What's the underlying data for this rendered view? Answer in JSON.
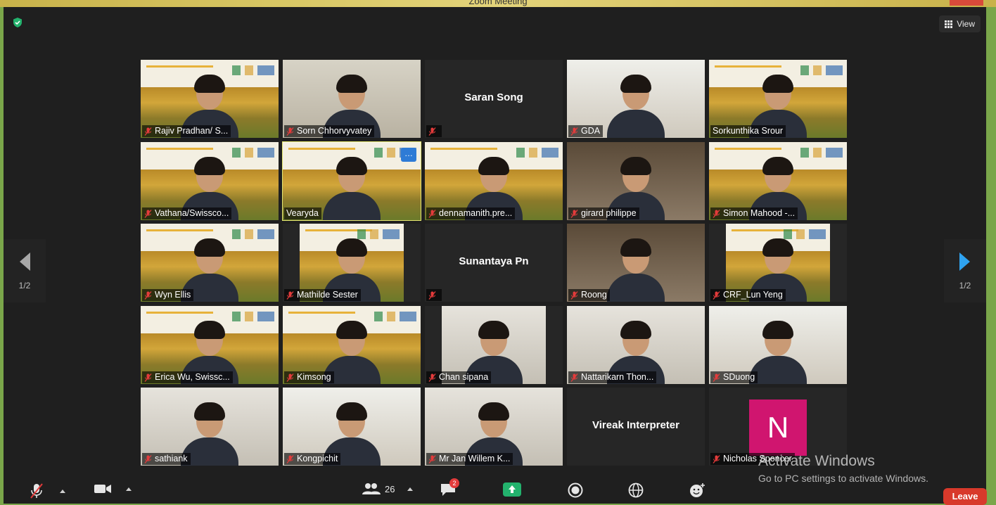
{
  "window": {
    "title": "Zoom Meeting"
  },
  "header": {
    "view_label": "View"
  },
  "pagination": {
    "current": "1/2"
  },
  "participants": [
    {
      "name": "Rajiv Pradhan/ S...",
      "muted": true,
      "video": "rice"
    },
    {
      "name": "Sorn Chhorvyvatey",
      "muted": true,
      "video": "office"
    },
    {
      "name": "",
      "center_name": "Saran Song",
      "muted": true,
      "video": "none"
    },
    {
      "name": "GDA",
      "muted": true,
      "video": "room"
    },
    {
      "name": "Sorkunthika Srour",
      "muted": false,
      "video": "rice"
    },
    {
      "name": "Vathana/Swissco...",
      "muted": true,
      "video": "rice"
    },
    {
      "name": "Vearyda",
      "muted": false,
      "video": "rice",
      "active": true
    },
    {
      "name": "dennamanith.pre...",
      "muted": true,
      "video": "rice"
    },
    {
      "name": "girard philippe",
      "muted": true,
      "video": "dark"
    },
    {
      "name": "Simon Mahood -...",
      "muted": true,
      "video": "rice"
    },
    {
      "name": "Wyn Ellis",
      "muted": true,
      "video": "rice"
    },
    {
      "name": "Mathilde Sester",
      "muted": true,
      "video": "rice-narrow"
    },
    {
      "name": "",
      "center_name": "Sunantaya Pn",
      "muted": true,
      "video": "none"
    },
    {
      "name": "Roong",
      "muted": true,
      "video": "dark"
    },
    {
      "name": "CRF_Lun Yeng",
      "muted": true,
      "video": "rice-narrow"
    },
    {
      "name": "Erica Wu, Swissc...",
      "muted": true,
      "video": "rice"
    },
    {
      "name": "Kimsong",
      "muted": true,
      "video": "rice"
    },
    {
      "name": "Chan sipana",
      "muted": true,
      "video": "wall-narrow"
    },
    {
      "name": "Nattarikarn Thon...",
      "muted": true,
      "video": "wall"
    },
    {
      "name": "SDuong",
      "muted": true,
      "video": "room"
    },
    {
      "name": "sathiank",
      "muted": true,
      "video": "wall"
    },
    {
      "name": "Kongpichit",
      "muted": true,
      "video": "room"
    },
    {
      "name": "Mr Jan Willem K...",
      "muted": true,
      "video": "wall"
    },
    {
      "name": "",
      "center_name": "Vireak Interpreter",
      "muted": false,
      "video": "none"
    },
    {
      "name": "Nicholas Spencer",
      "muted": true,
      "video": "avatar",
      "avatar_letter": "N"
    }
  ],
  "toolbar": {
    "participants_count": "26",
    "chat_badge": "2",
    "leave_label": "Leave"
  },
  "watermark": {
    "line1": "Activate Windows",
    "line2": "Go to PC settings to activate Windows."
  },
  "colors": {
    "leave": "#d8392b",
    "active_border": "#e6e872",
    "avatar": "#d0156f"
  }
}
